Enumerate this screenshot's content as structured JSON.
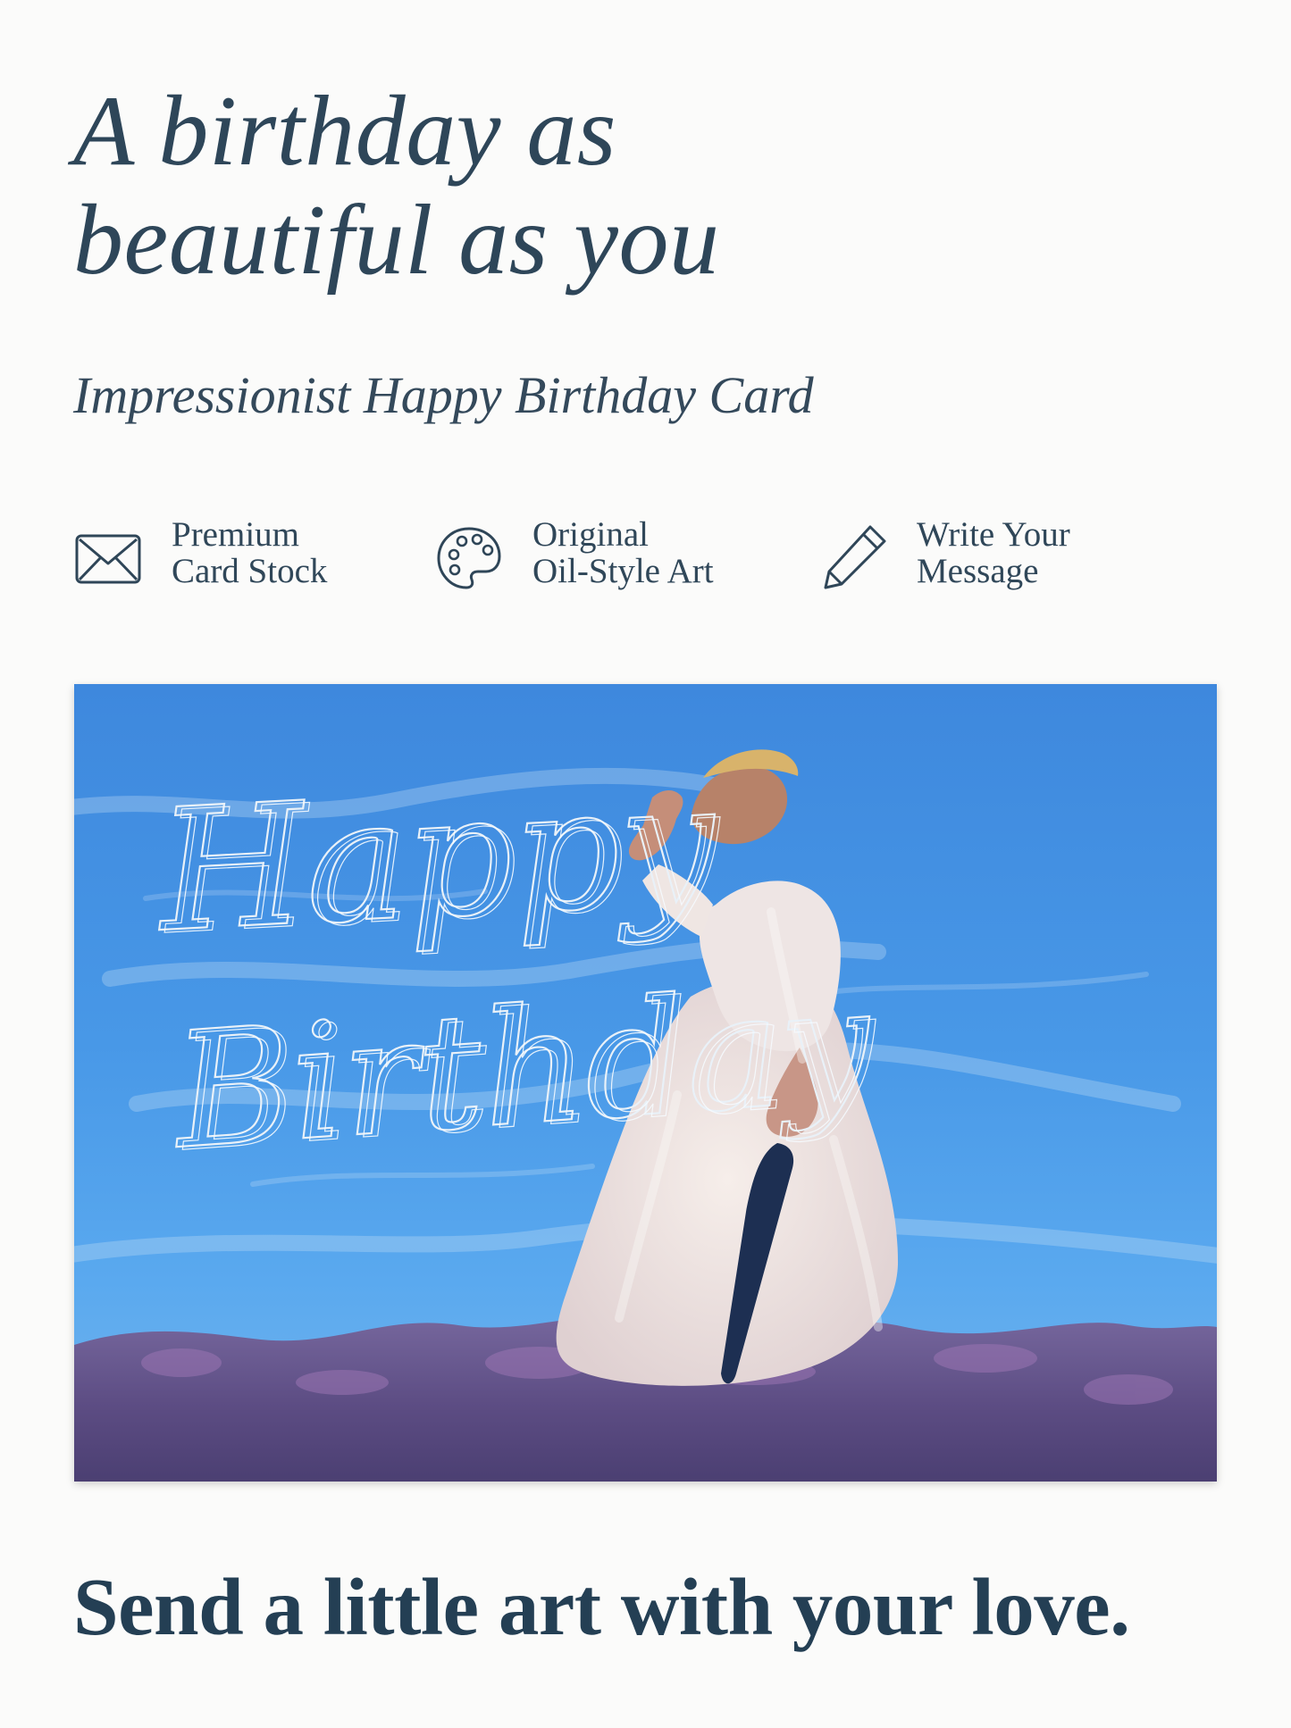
{
  "header": {
    "headline_line_1": "A birthday as",
    "headline_line_2": "beautiful as you",
    "subtitle": "Impressionist Happy Birthday Card"
  },
  "features": [
    {
      "icon": "envelope-icon",
      "line_1": "Premium",
      "line_2": "Card Stock"
    },
    {
      "icon": "palette-icon",
      "line_1": "Original",
      "line_2": "Oil-Style Art"
    },
    {
      "icon": "pencil-icon",
      "line_1": "Write Your",
      "line_2": "Message"
    }
  ],
  "card": {
    "greeting_line_1": "Happy",
    "greeting_line_2": "Birthday"
  },
  "footer": {
    "tagline": "Send a little art with your love."
  },
  "colors": {
    "text": "#2c4356",
    "sky_blue": "#4a95e3",
    "meadow_purple": "#6b5a8f",
    "dress": "#efe3e0"
  }
}
